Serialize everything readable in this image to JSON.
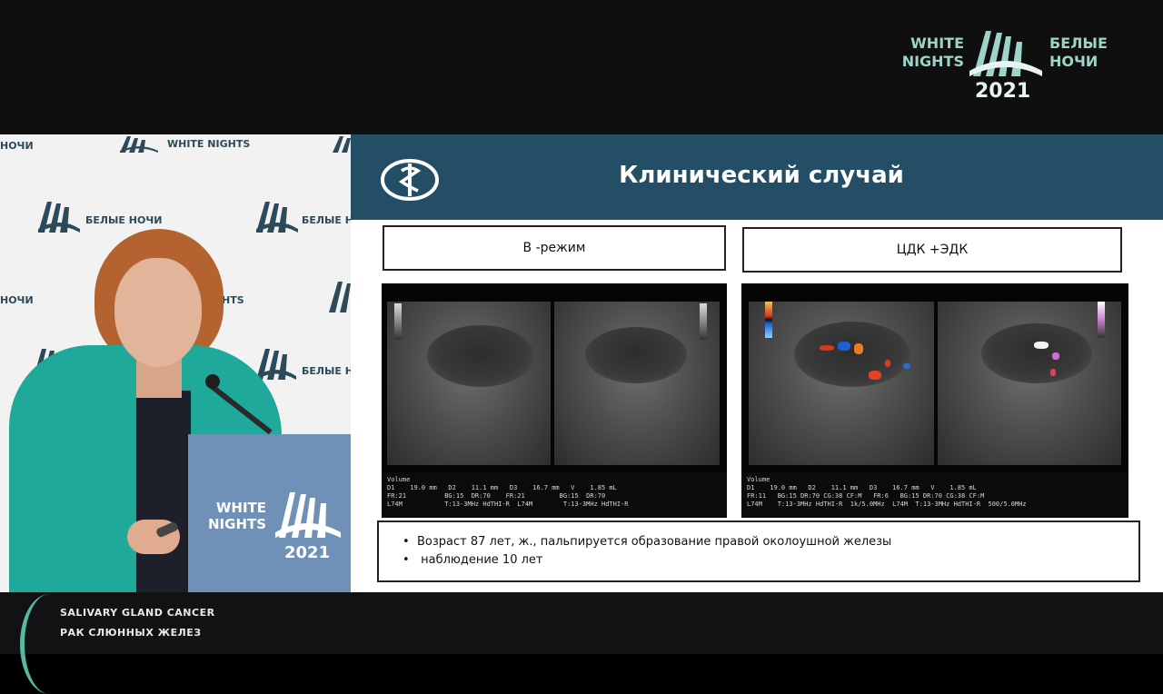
{
  "event_logo": {
    "left_line1": "WHITE",
    "left_line2": "NIGHTS",
    "right_line1": "БЕЛЫЕ",
    "right_line2": "НОЧИ",
    "year": "2021"
  },
  "backdrop": {
    "logo_white_nights": "WHITE NIGHTS",
    "logo_belye_nochi": "БЕЛЫЕ НОЧИ",
    "fragment_nochi": "НОЧИ",
    "fragment_hts": "HTS",
    "fragment_belye_n": "БЕЛЫЕ Н"
  },
  "podium": {
    "line1": "WHITE",
    "line2": "NIGHTS",
    "year": "2021"
  },
  "slide": {
    "title": "Клинический случай",
    "mode_b_label": "В -режим",
    "mode_cdk_label": "ЦДК +ЭДК",
    "us_left_readout": "Volume\nD1    19.0 mm   D2    11.1 mm   D3    16.7 mm   V    1.85 mL\nFR:21          BG:15  DR:70    FR:21         BG:15  DR:70\nL74M           T:13-3MHz HdTHI-R  L74M        T:13-3MHz HdTHI-R",
    "us_right_readout": "Volume\nD1    19.0 mm   D2    11.1 mm   D3    16.7 mm   V    1.85 mL\nFR:11   BG:15 DR:70 CG:38 CF:M   FR:6   BG:15 DR:70 CG:38 CF:M\nL74M    T:13-3MHz HdTHI-R  1k/5.0MHz  L74M  T:13-3MHz HdTHI-R  500/5.0MHz",
    "info_line1": "Возраст 87 лет, ж., пальпируется  образование правой околоушной железы",
    "info_line2": " наблюдение  10  лет",
    "bullet": "•"
  },
  "lower_third": {
    "line1": "SALIVARY GLAND CANCER",
    "line2": "РАК СЛЮННЫХ ЖЕЛЕЗ"
  },
  "colors": {
    "slide_header": "#234e66",
    "accent_teal": "#57b9a3",
    "podium": "#6f90b7"
  }
}
